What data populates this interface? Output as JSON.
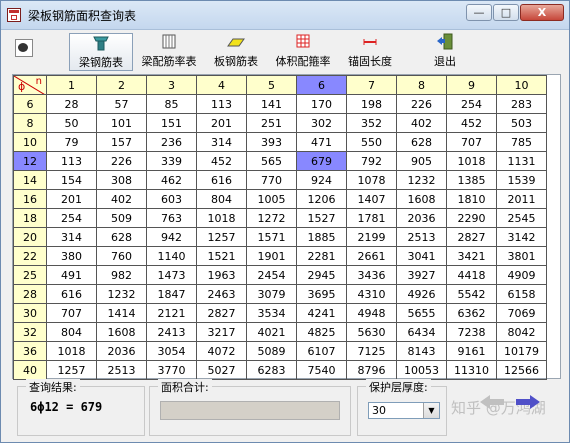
{
  "window": {
    "title": "梁板钢筋面积查询表",
    "min_label": "—",
    "max_label": "□",
    "close_label": "X"
  },
  "toolbar": {
    "items": [
      {
        "label": "梁钢筋表",
        "icon": "beam-rebar-icon"
      },
      {
        "label": "梁配筋率表",
        "icon": "beam-ratio-icon"
      },
      {
        "label": "板钢筋表",
        "icon": "slab-rebar-icon"
      },
      {
        "label": "体积配箍率",
        "icon": "stirrup-ratio-icon"
      },
      {
        "label": "锚固长度",
        "icon": "anchorage-icon"
      },
      {
        "label": "退出",
        "icon": "exit-icon"
      }
    ]
  },
  "table": {
    "corner_phi": "ϕ",
    "corner_n": "n",
    "columns": [
      "1",
      "2",
      "3",
      "4",
      "5",
      "6",
      "7",
      "8",
      "9",
      "10"
    ],
    "selected_column": 5,
    "selected_row": 3,
    "rows": [
      {
        "d": "6",
        "values": [
          "28",
          "57",
          "85",
          "113",
          "141",
          "170",
          "198",
          "226",
          "254",
          "283"
        ]
      },
      {
        "d": "8",
        "values": [
          "50",
          "101",
          "151",
          "201",
          "251",
          "302",
          "352",
          "402",
          "452",
          "503"
        ]
      },
      {
        "d": "10",
        "values": [
          "79",
          "157",
          "236",
          "314",
          "393",
          "471",
          "550",
          "628",
          "707",
          "785"
        ]
      },
      {
        "d": "12",
        "values": [
          "113",
          "226",
          "339",
          "452",
          "565",
          "679",
          "792",
          "905",
          "1018",
          "1131"
        ]
      },
      {
        "d": "14",
        "values": [
          "154",
          "308",
          "462",
          "616",
          "770",
          "924",
          "1078",
          "1232",
          "1385",
          "1539"
        ]
      },
      {
        "d": "16",
        "values": [
          "201",
          "402",
          "603",
          "804",
          "1005",
          "1206",
          "1407",
          "1608",
          "1810",
          "2011"
        ]
      },
      {
        "d": "18",
        "values": [
          "254",
          "509",
          "763",
          "1018",
          "1272",
          "1527",
          "1781",
          "2036",
          "2290",
          "2545"
        ]
      },
      {
        "d": "20",
        "values": [
          "314",
          "628",
          "942",
          "1257",
          "1571",
          "1885",
          "2199",
          "2513",
          "2827",
          "3142"
        ]
      },
      {
        "d": "22",
        "values": [
          "380",
          "760",
          "1140",
          "1521",
          "1901",
          "2281",
          "2661",
          "3041",
          "3421",
          "3801"
        ]
      },
      {
        "d": "25",
        "values": [
          "491",
          "982",
          "1473",
          "1963",
          "2454",
          "2945",
          "3436",
          "3927",
          "4418",
          "4909"
        ]
      },
      {
        "d": "28",
        "values": [
          "616",
          "1232",
          "1847",
          "2463",
          "3079",
          "3695",
          "4310",
          "4926",
          "5542",
          "6158"
        ]
      },
      {
        "d": "30",
        "values": [
          "707",
          "1414",
          "2121",
          "2827",
          "3534",
          "4241",
          "4948",
          "5655",
          "6362",
          "7069"
        ]
      },
      {
        "d": "32",
        "values": [
          "804",
          "1608",
          "2413",
          "3217",
          "4021",
          "4825",
          "5630",
          "6434",
          "7238",
          "8042"
        ]
      },
      {
        "d": "36",
        "values": [
          "1018",
          "2036",
          "3054",
          "4072",
          "5089",
          "6107",
          "7125",
          "8143",
          "9161",
          "10179"
        ]
      },
      {
        "d": "40",
        "values": [
          "1257",
          "2513",
          "3770",
          "5027",
          "6283",
          "7540",
          "8796",
          "10053",
          "11310",
          "12566"
        ]
      }
    ]
  },
  "status": {
    "query_label": "查询结果:",
    "query_value": "6ϕ12 = 679",
    "area_label": "面积合计:",
    "area_value": "",
    "cover_label": "保护层厚度:",
    "cover_value": "30"
  },
  "watermark": "知乎 @万鸿湖",
  "colors": {
    "header": "#ffffcc",
    "selected": "#8888ff"
  }
}
